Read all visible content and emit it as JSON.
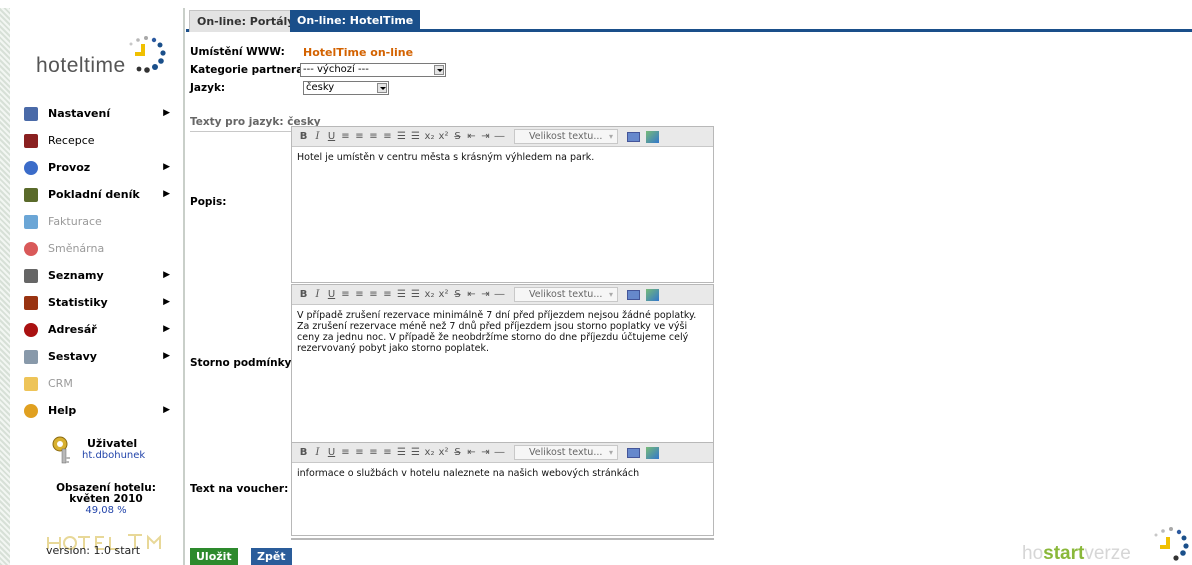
{
  "app": {
    "logo_text": "hoteltime",
    "version": "version: 1.0 start"
  },
  "sidebar": {
    "items": [
      {
        "label": "Nastavení",
        "bold": true,
        "arrow": true,
        "icon": "settings-icon",
        "color": "#4a6aa8"
      },
      {
        "label": "Recepce",
        "bold": false,
        "arrow": false,
        "icon": "bell-icon",
        "color": "#8a2020"
      },
      {
        "label": "Provoz",
        "bold": true,
        "arrow": true,
        "icon": "gear-icon",
        "color": "#3b6cc9"
      },
      {
        "label": "Pokladní deník",
        "bold": true,
        "arrow": true,
        "icon": "cash-book-icon",
        "color": "#5a6a2a"
      },
      {
        "label": "Fakturace",
        "bold": false,
        "arrow": false,
        "disabled": true,
        "icon": "invoice-icon",
        "color": "#3a88c8"
      },
      {
        "label": "Směnárna",
        "bold": false,
        "arrow": false,
        "disabled": true,
        "icon": "exchange-icon",
        "color": "#cc2222"
      },
      {
        "label": "Seznamy",
        "bold": true,
        "arrow": true,
        "icon": "list-icon",
        "color": "#666666"
      },
      {
        "label": "Statistiky",
        "bold": true,
        "arrow": true,
        "icon": "statistics-icon",
        "color": "#993311"
      },
      {
        "label": "Adresář",
        "bold": true,
        "arrow": true,
        "icon": "address-book-icon",
        "color": "#aa1111"
      },
      {
        "label": "Sestavy",
        "bold": true,
        "arrow": true,
        "icon": "reports-icon",
        "color": "#8899aa"
      },
      {
        "label": "CRM",
        "bold": false,
        "arrow": false,
        "disabled": true,
        "icon": "crm-icon",
        "color": "#e8b020"
      },
      {
        "label": "Help",
        "bold": true,
        "arrow": true,
        "icon": "help-icon",
        "color": "#e0a020"
      }
    ],
    "user_label": "Uživatel",
    "user_name": "ht.dbohunek",
    "occupancy_title": "Obsazení hotelu:",
    "occupancy_period": "květen 2010",
    "occupancy_value": "49,08 %"
  },
  "tabs": [
    {
      "label": "On-line: Portály",
      "active": false
    },
    {
      "label": "On-line: HotelTime",
      "active": true
    }
  ],
  "form": {
    "www_label": "Umístění WWW:",
    "www_value": "HotelTime on-line",
    "partner_label": "Kategorie partnera:",
    "partner_value": "--- výchozí ---",
    "lang_label": "Jazyk:",
    "lang_value": "česky",
    "texts_header": "Texty pro jazyk: česky",
    "toolbar_size_placeholder": "Velikost textu...",
    "popis_label": "Popis:",
    "popis_text": "Hotel je umístěn v centru města s krásným výhledem na park.",
    "storno_label": "Storno podmínky:",
    "storno_text": "V případě zrušení rezervace minimálně 7 dní před příjezdem nejsou žádné poplatky. Za zrušení rezervace méně než 7 dnů před příjezdem jsou storno poplatky ve výši ceny za jednu noc. V případě že neobdržíme storno do dne příjezdu účtujeme celý rezervovaný pobyt jako storno poplatek.",
    "voucher_label": "Text na voucher:",
    "voucher_text": "informace o službách v hotelu naleznete na našich webových stránkách"
  },
  "buttons": {
    "save": "Uložit",
    "back": "Zpět"
  },
  "footer": {
    "brand_prefix": "ho",
    "brand_mid": "start",
    "brand_suffix": "verze"
  },
  "colors": {
    "accent": "#1a4f8a",
    "orange": "#d36200",
    "save_green": "#2d8a2d"
  }
}
